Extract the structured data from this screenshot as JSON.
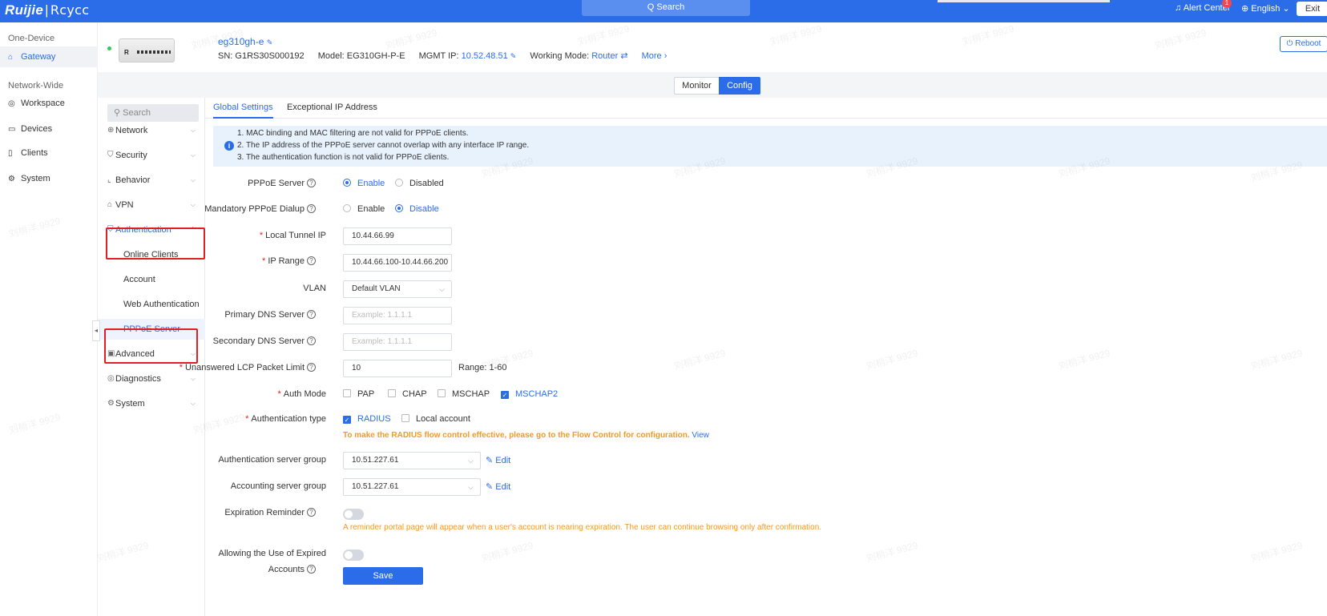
{
  "topbar": {
    "logo_brand": "Ruijie",
    "logo_sep": "|",
    "logo_product": "Rcycc",
    "search_label": "Q Search",
    "alert_label": "Alert Center",
    "alert_count": "1",
    "language": "English",
    "exit_label": "Exit"
  },
  "leftnav": {
    "section_one_device": "One-Device",
    "gateway": "Gateway",
    "section_network_wide": "Network-Wide",
    "workspace": "Workspace",
    "devices": "Devices",
    "clients": "Clients",
    "system": "System"
  },
  "device": {
    "name": "eg310gh-e",
    "sn_label": "SN:",
    "sn": "G1RS30S000192",
    "model_label": "Model:",
    "model": "EG310GH-P-E",
    "mgmt_label": "MGMT IP:",
    "mgmt_ip": "10.52.48.51",
    "mode_label": "Working Mode:",
    "mode": "Router",
    "more": "More",
    "reboot": "Reboot",
    "image_text": "R"
  },
  "view_toggle": {
    "monitor": "Monitor",
    "config": "Config"
  },
  "subnav": {
    "search_placeholder": "Search",
    "network": "Network",
    "security": "Security",
    "behavior": "Behavior",
    "vpn": "VPN",
    "authentication": "Authentication",
    "online_clients": "Online Clients",
    "account": "Account",
    "web_authentication": "Web Authentication",
    "pppoe_server": "PPPoE Server",
    "advanced": "Advanced",
    "diagnostics": "Diagnostics",
    "system": "System"
  },
  "tabs": {
    "global": "Global Settings",
    "exceptional": "Exceptional IP Address"
  },
  "info": {
    "line1": "1. MAC binding and MAC filtering are not valid for PPPoE clients.",
    "line2": "2. The IP address of the PPPoE server cannot overlap with any interface IP range.",
    "line3": "3. The authentication function is not valid for PPPoE clients."
  },
  "form": {
    "pppoe_server_label": "PPPoE Server",
    "enable": "Enable",
    "disabled": "Disabled",
    "mandatory_label": "Mandatory PPPoE Dialup",
    "disable": "Disable",
    "local_tunnel_label": "Local Tunnel IP",
    "local_tunnel_value": "10.44.66.99",
    "ip_range_label": "IP Range",
    "ip_range_value": "10.44.66.100-10.44.66.200",
    "vlan_label": "VLAN",
    "vlan_value": "Default VLAN",
    "primary_dns_label": "Primary DNS Server",
    "primary_dns_placeholder": "Example: 1.1.1.1",
    "secondary_dns_label": "Secondary DNS Server",
    "secondary_dns_placeholder": "Example: 1.1.1.1",
    "lcp_label": "Unanswered LCP Packet Limit",
    "lcp_value": "10",
    "lcp_range": "Range: 1-60",
    "auth_mode_label": "Auth Mode",
    "pap": "PAP",
    "chap": "CHAP",
    "mschap": "MSCHAP",
    "mschap2": "MSCHAP2",
    "auth_type_label": "Authentication type",
    "radius": "RADIUS",
    "local_account": "Local account",
    "radius_note": "To make the RADIUS flow control effective, please go to the Flow Control for configuration.",
    "view": "View",
    "auth_server_label": "Authentication server group",
    "auth_server_value": "10.51.227.61",
    "acct_server_label": "Accounting server group",
    "acct_server_value": "10.51.227.61",
    "edit": "Edit",
    "expiration_label": "Expiration Reminder",
    "expiration_note": "A reminder portal page will appear when a user's account is nearing expiration. The user can continue browsing only after confirmation.",
    "expired_label_1": "Allowing the Use of Expired",
    "expired_label_2": "Accounts",
    "save": "Save"
  },
  "watermark_text": "刘梢洋 9929",
  "colors": {
    "accent": "#2b6de8",
    "warning": "#f59a23",
    "highlight_box": "#e02020"
  }
}
